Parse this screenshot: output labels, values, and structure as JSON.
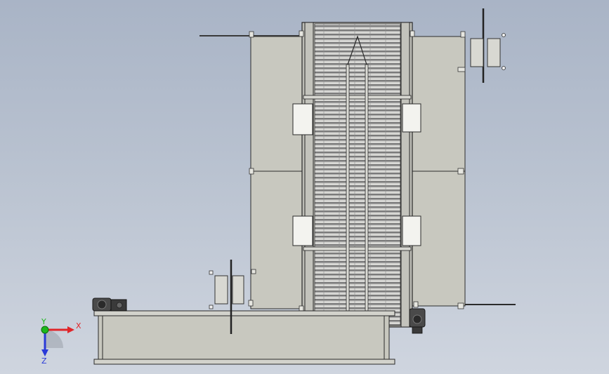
{
  "viewport": {
    "background_top": "#a9b4c6",
    "background_bottom": "#cfd5df"
  },
  "model": {
    "panel_fill": "#c8c8bf",
    "panel_stroke": "#2c2c2c",
    "roller_dark": "#7e7e7e",
    "roller_light": "#d2d2d2",
    "bracket_fill": "#f2f2ee"
  },
  "triad": {
    "x_label": "X",
    "y_label": "Y",
    "z_label": "Z",
    "x_color": "#e0262a",
    "y_color": "#1db81d",
    "z_color": "#2a3ad8"
  }
}
